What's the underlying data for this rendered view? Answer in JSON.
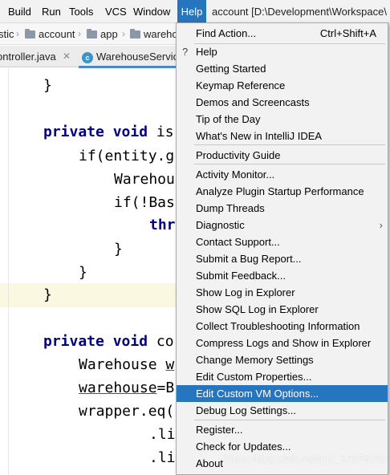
{
  "menubar": {
    "items": [
      "Build",
      "Run",
      "Tools",
      "VCS",
      "Window",
      "Help"
    ],
    "active": "Help",
    "title": "account [D:\\Development\\Workspace\\"
  },
  "breadcrumb": [
    "stic",
    "account",
    "app",
    "wareho"
  ],
  "tabs": [
    {
      "label": "ontroller.java"
    },
    {
      "label": "WarehouseServic"
    }
  ],
  "code_lines": [
    {
      "text": "}"
    },
    {
      "kw": "private void",
      "text": " is"
    },
    {
      "text": "if(entity.g"
    },
    {
      "text": "Warehou"
    },
    {
      "text": "if(!Bas"
    },
    {
      "kw": "thr"
    },
    {
      "text": "}"
    },
    {
      "text": "}"
    },
    {
      "text": "}"
    },
    {
      "kw": "private void",
      "text": " co"
    },
    {
      "text": "Warehouse ",
      "ul": "w"
    },
    {
      "ul": "warehouse",
      "text": "=B"
    },
    {
      "text": "wrapper.eq("
    },
    {
      "text": ".li"
    },
    {
      "text": ".li"
    }
  ],
  "help_menu": {
    "items": [
      {
        "label": "Find Action...",
        "shortcut": "Ctrl+Shift+A"
      },
      {
        "label": "Help",
        "icon": "?"
      },
      {
        "label": "Getting Started"
      },
      {
        "label": "Keymap Reference"
      },
      {
        "label": "Demos and Screencasts"
      },
      {
        "label": "Tip of the Day"
      },
      {
        "label": "What's New in IntelliJ IDEA"
      },
      {
        "label": "Productivity Guide"
      },
      {
        "label": "Activity Monitor..."
      },
      {
        "label": "Analyze Plugin Startup Performance"
      },
      {
        "label": "Dump Threads"
      },
      {
        "label": "Diagnostic",
        "submenu_arrow": "›"
      },
      {
        "label": "Contact Support..."
      },
      {
        "label": "Submit a Bug Report..."
      },
      {
        "label": "Submit Feedback..."
      },
      {
        "label": "Show Log in Explorer"
      },
      {
        "label": "Show SQL Log in Explorer"
      },
      {
        "label": "Collect Troubleshooting Information"
      },
      {
        "label": "Compress Logs and Show in Explorer"
      },
      {
        "label": "Change Memory Settings"
      },
      {
        "label": "Edit Custom Properties..."
      },
      {
        "label": "Edit Custom VM Options..."
      },
      {
        "label": "Debug Log Settings..."
      },
      {
        "label": "Register..."
      },
      {
        "label": "Check for Updates..."
      },
      {
        "label": "About"
      }
    ],
    "highlighted": "Edit Custom VM Options..."
  },
  "watermark": "https://blog.csdn.net/m0_37679060",
  "colors": {
    "highlight": "#2675bf",
    "keyword": "#000080",
    "current_line": "#fbf8e1"
  },
  "icons": {
    "folder": "folder-icon",
    "class": "class-c-icon",
    "close": "close-icon"
  }
}
